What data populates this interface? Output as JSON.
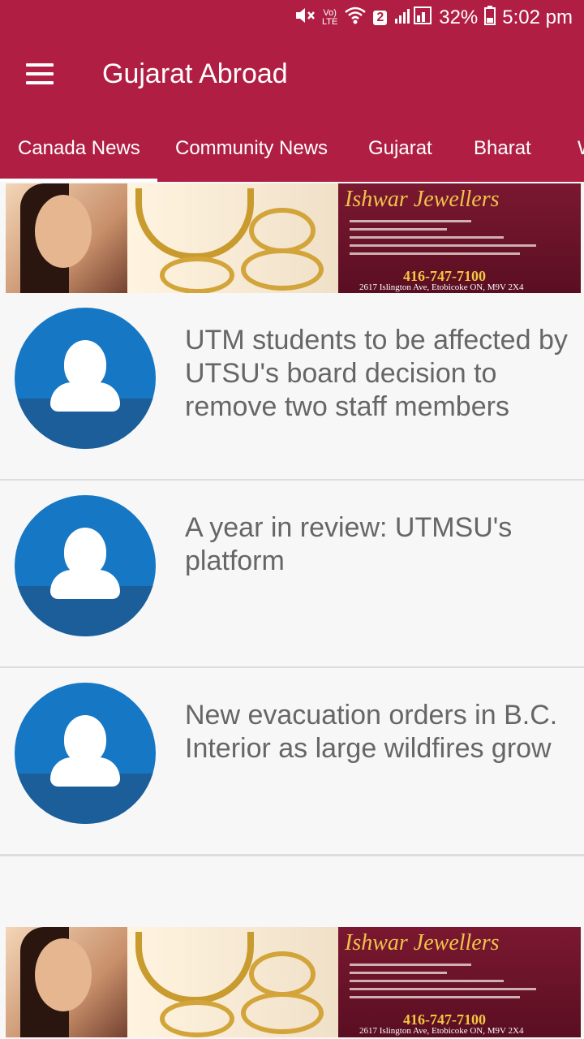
{
  "status": {
    "battery": "32%",
    "time": "5:02 pm",
    "sim_slot": "2",
    "lte": "LTE"
  },
  "app": {
    "title": "Gujarat Abroad"
  },
  "tabs": [
    {
      "label": "Canada News",
      "active": true
    },
    {
      "label": "Community News",
      "active": false
    },
    {
      "label": "Gujarat",
      "active": false
    },
    {
      "label": "Bharat",
      "active": false
    },
    {
      "label": "W",
      "active": false
    }
  ],
  "banner": {
    "brand": "Ishwar Jewellers",
    "phone": "416-747-7100",
    "address": "2617 Islington Ave, Etobicoke ON, M9V 2X4"
  },
  "news": [
    {
      "title": "UTM students to be affected by UTSU's board decision to remove two staff members"
    },
    {
      "title": "A year in review: UTMSU's platform"
    },
    {
      "title": "New evacuation orders in B.C. Interior as large wildfires grow"
    }
  ],
  "colors": {
    "primary": "#b01f43",
    "avatar_blue": "#1677c4",
    "avatar_dark": "#1b5e99",
    "text_gray": "#666666"
  }
}
